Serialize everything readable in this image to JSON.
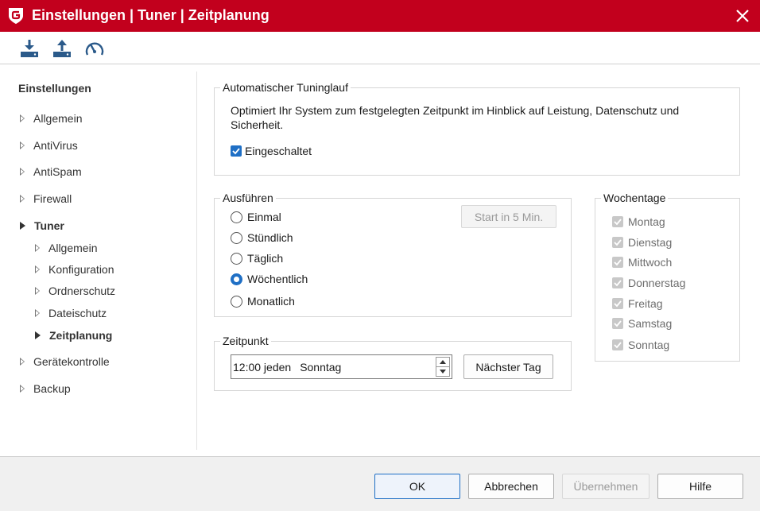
{
  "window": {
    "title": "Einstellungen | Tuner | Zeitplanung",
    "accent_color": "#c2001d"
  },
  "toolbar": {
    "icons": [
      "download-icon",
      "upload-icon",
      "speedometer-icon"
    ]
  },
  "sidebar": {
    "heading": "Einstellungen",
    "items": [
      {
        "label": "Allgemein",
        "level": 0
      },
      {
        "label": "AntiVirus",
        "level": 0
      },
      {
        "label": "AntiSpam",
        "level": 0
      },
      {
        "label": "Firewall",
        "level": 0
      },
      {
        "label": "Tuner",
        "level": 0,
        "expanded": true
      },
      {
        "label": "Allgemein",
        "level": 1
      },
      {
        "label": "Konfiguration",
        "level": 1
      },
      {
        "label": "Ordnerschutz",
        "level": 1
      },
      {
        "label": "Dateischutz",
        "level": 1
      },
      {
        "label": "Zeitplanung",
        "level": 1,
        "selected": true
      },
      {
        "label": "Gerätekontrolle",
        "level": 0
      },
      {
        "label": "Backup",
        "level": 0
      }
    ]
  },
  "auto": {
    "legend": "Automatischer Tuninglauf",
    "description_line1": "Optimiert Ihr System zum festgelegten Zeitpunkt im Hinblick auf Leistung, Datenschutz und",
    "description_line2": "Sicherheit.",
    "enabled_label": "Eingeschaltet",
    "enabled": true
  },
  "run": {
    "legend": "Ausführen",
    "options": [
      "Einmal",
      "Stündlich",
      "Täglich",
      "Wöchentlich",
      "Monatlich"
    ],
    "selected": "Wöchentlich",
    "start_button": "Start in 5 Min."
  },
  "time": {
    "legend": "Zeitpunkt",
    "value_time": "12:00 jeden",
    "value_day": "Sonntag",
    "next_day_button": "Nächster Tag"
  },
  "weekdays": {
    "legend": "Wochentage",
    "days": [
      "Montag",
      "Dienstag",
      "Mittwoch",
      "Donnerstag",
      "Freitag",
      "Samstag",
      "Sonntag"
    ]
  },
  "footer": {
    "ok": "OK",
    "cancel": "Abbrechen",
    "apply": "Übernehmen",
    "help": "Hilfe"
  }
}
